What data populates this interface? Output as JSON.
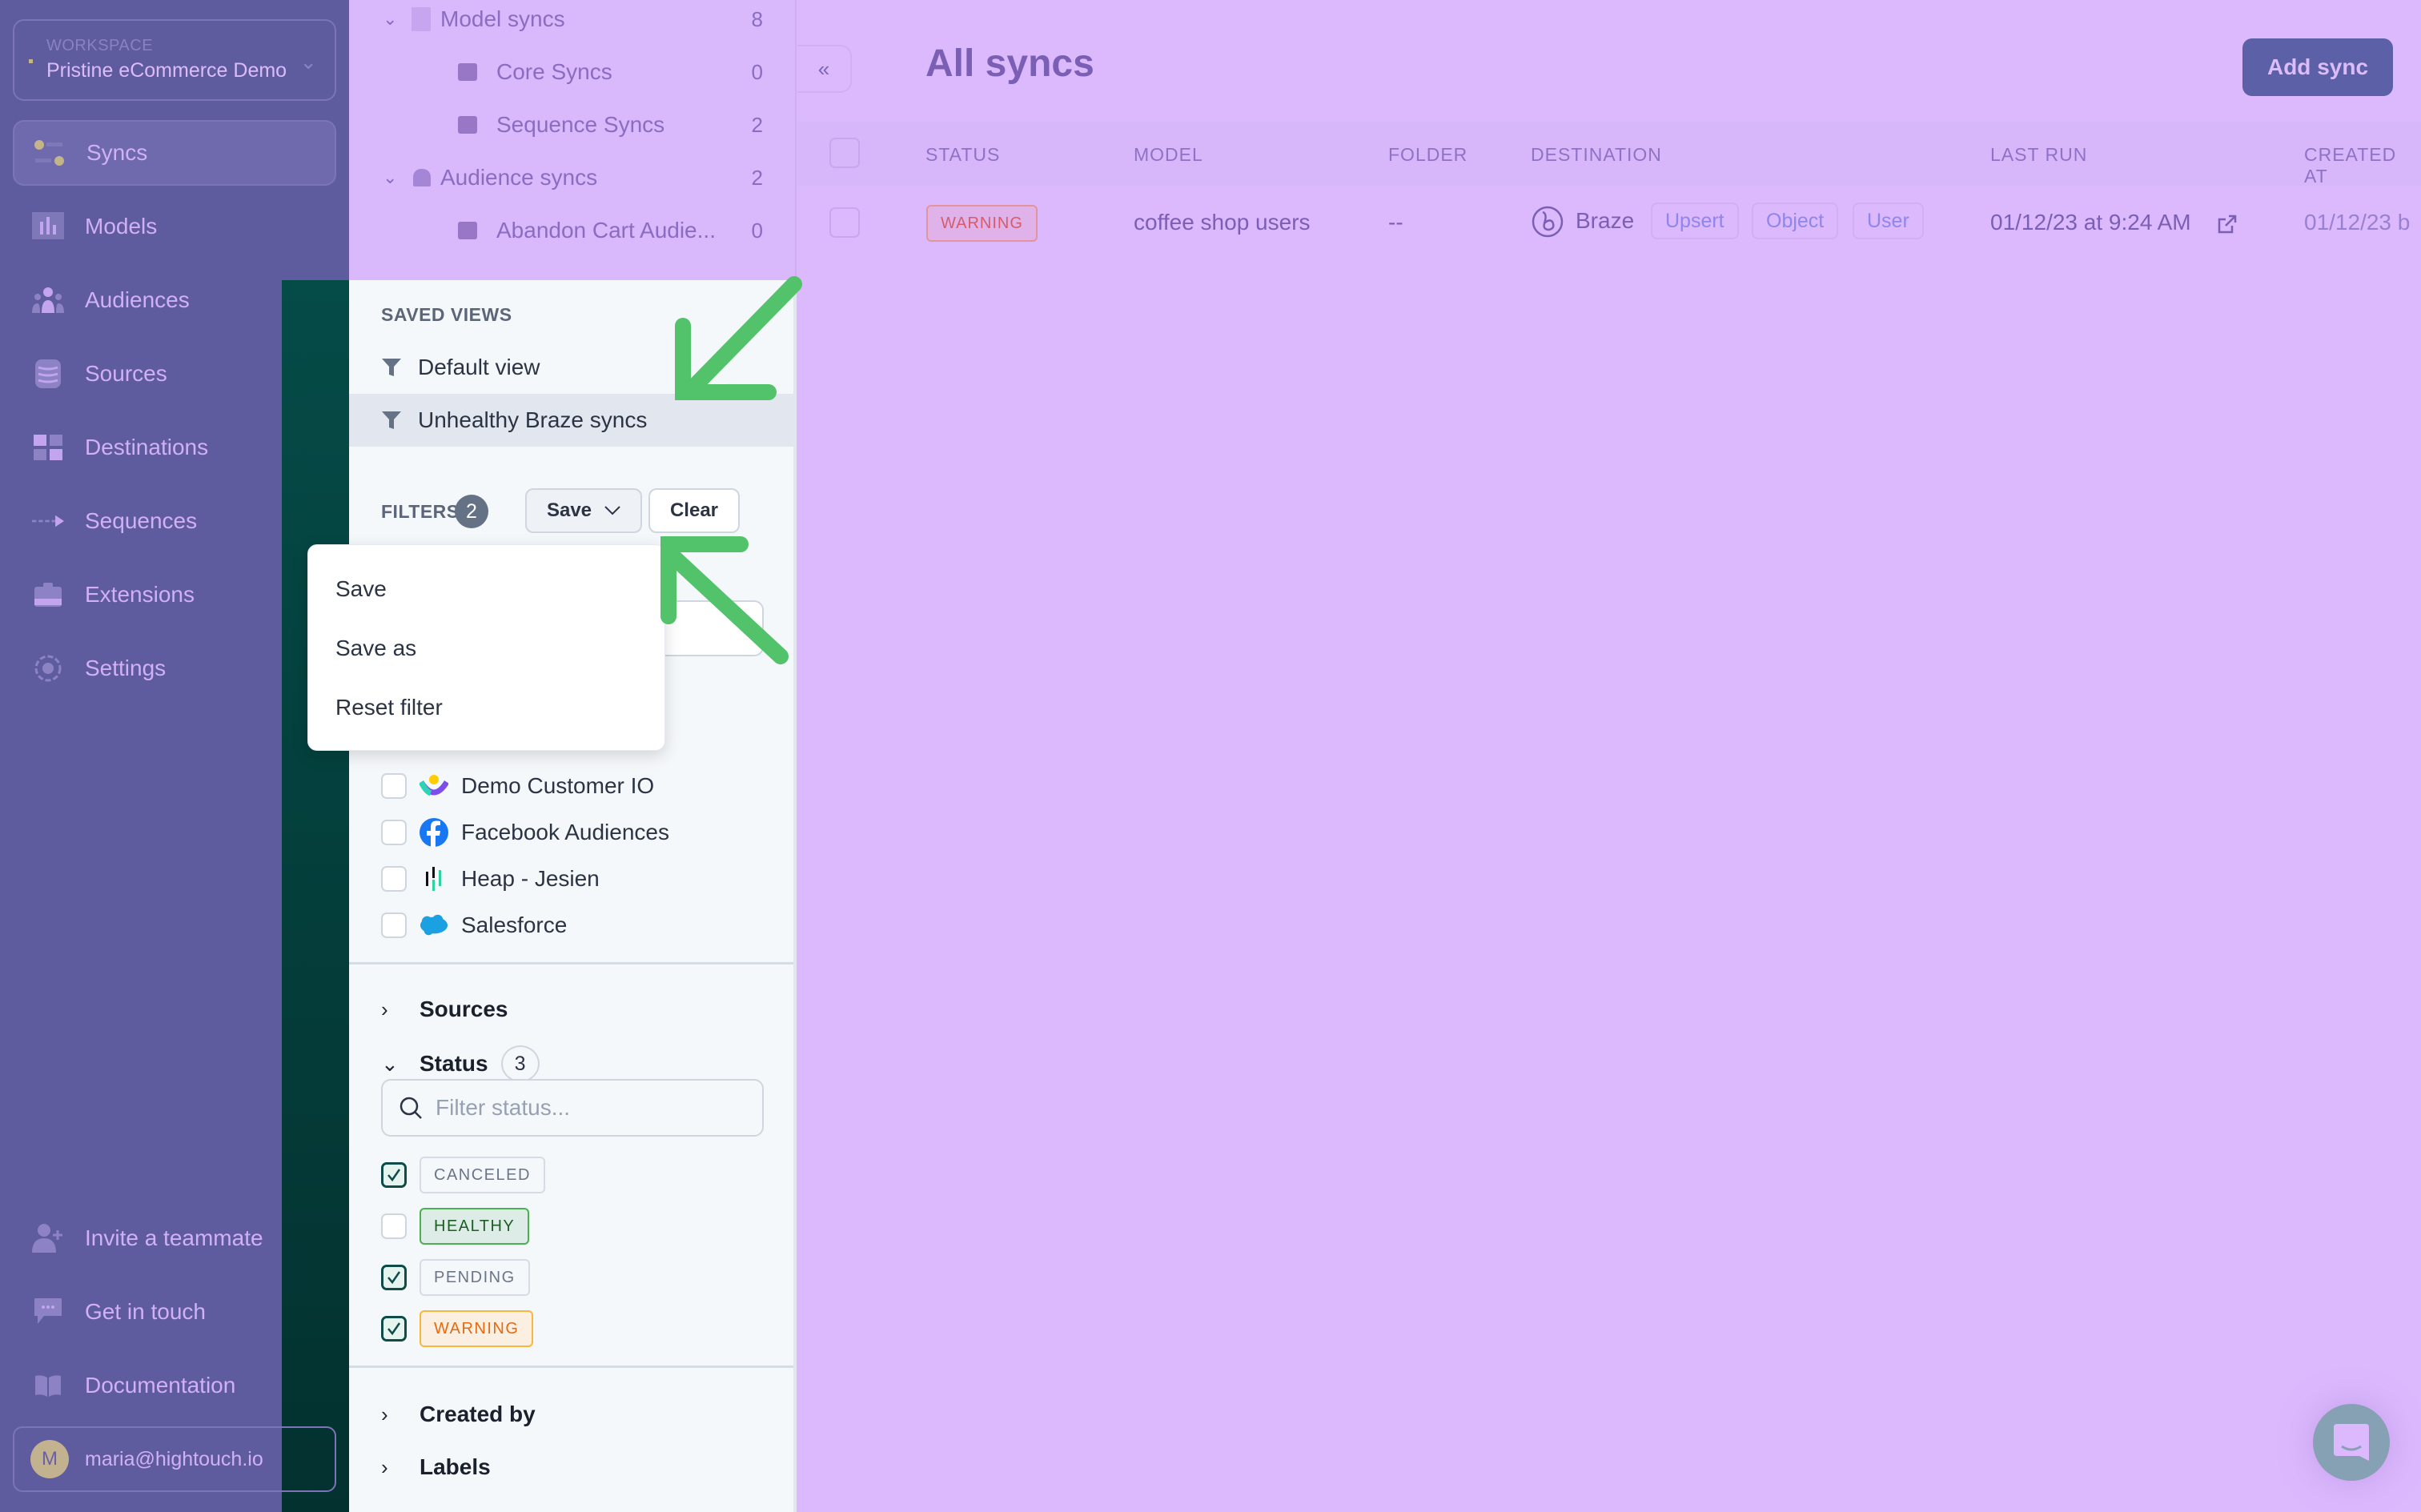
{
  "workspace": {
    "label": "WORKSPACE",
    "name": "Pristine eCommerce Demo"
  },
  "sidebar": {
    "items": [
      {
        "label": "Syncs",
        "icon": "syncs-icon",
        "active": true
      },
      {
        "label": "Models",
        "icon": "models-icon"
      },
      {
        "label": "Audiences",
        "icon": "audiences-icon"
      },
      {
        "label": "Sources",
        "icon": "database-icon"
      },
      {
        "label": "Destinations",
        "icon": "destinations-icon"
      },
      {
        "label": "Sequences",
        "icon": "sequences-icon"
      },
      {
        "label": "Extensions",
        "icon": "briefcase-icon"
      },
      {
        "label": "Settings",
        "icon": "gear-icon"
      }
    ],
    "bottom": [
      {
        "label": "Invite a teammate",
        "icon": "add-user-icon"
      },
      {
        "label": "Get in touch",
        "icon": "chat-bubble-icon"
      },
      {
        "label": "Documentation",
        "icon": "book-icon"
      }
    ],
    "user": {
      "initial": "M",
      "email": "maria@hightouch.io"
    }
  },
  "folders": {
    "groups": [
      {
        "label": "Model syncs",
        "count": "8",
        "children": [
          {
            "label": "Core Syncs",
            "count": "0"
          },
          {
            "label": "Sequence Syncs",
            "count": "2"
          }
        ]
      },
      {
        "label": "Audience syncs",
        "count": "2",
        "children": [
          {
            "label": "Abandon Cart Audie...",
            "count": "0"
          }
        ]
      }
    ]
  },
  "saved_views": {
    "heading": "SAVED VIEWS",
    "items": [
      {
        "label": "Default view",
        "selected": false
      },
      {
        "label": "Unhealthy Braze syncs",
        "selected": true
      }
    ]
  },
  "filters": {
    "label": "FILTERS",
    "count": "2",
    "save_label": "Save",
    "clear_label": "Clear",
    "save_menu": [
      "Save",
      "Save as",
      "Reset filter"
    ],
    "destinations": [
      {
        "name": "Demo Customer IO",
        "logo": "customer-io-logo",
        "checked": false
      },
      {
        "name": "Facebook Audiences",
        "logo": "facebook-logo",
        "checked": false
      },
      {
        "name": "Heap - Jesien",
        "logo": "heap-logo",
        "checked": false
      },
      {
        "name": "Salesforce",
        "logo": "salesforce-logo",
        "checked": false
      }
    ],
    "sections": {
      "sources": "Sources",
      "status": "Status",
      "status_count": "3",
      "created_by": "Created by",
      "labels": "Labels"
    },
    "status_placeholder": "Filter status...",
    "statuses": [
      {
        "label": "CANCELED",
        "checked": true,
        "kind": "neutral"
      },
      {
        "label": "HEALTHY",
        "checked": false,
        "kind": "healthy"
      },
      {
        "label": "PENDING",
        "checked": true,
        "kind": "neutral"
      },
      {
        "label": "WARNING",
        "checked": true,
        "kind": "warning"
      }
    ]
  },
  "main": {
    "title": "All syncs",
    "add_button": "Add sync",
    "columns": [
      "STATUS",
      "MODEL",
      "FOLDER",
      "DESTINATION",
      "LAST RUN",
      "CREATED AT"
    ],
    "rows": [
      {
        "status": "WARNING",
        "model": "coffee shop users",
        "folder": "--",
        "destination": "Braze",
        "tags": [
          "Upsert",
          "Object",
          "User"
        ],
        "last_run": "01/12/23 at 9:24 AM",
        "created_at": "01/12/23  b"
      }
    ]
  },
  "colors": {
    "brand_dark": "#054b47",
    "overlay": "#dcb9fd",
    "annotation_arrow": "#52c26b",
    "warning": "#e66a10",
    "healthy": "#1e5e24"
  }
}
